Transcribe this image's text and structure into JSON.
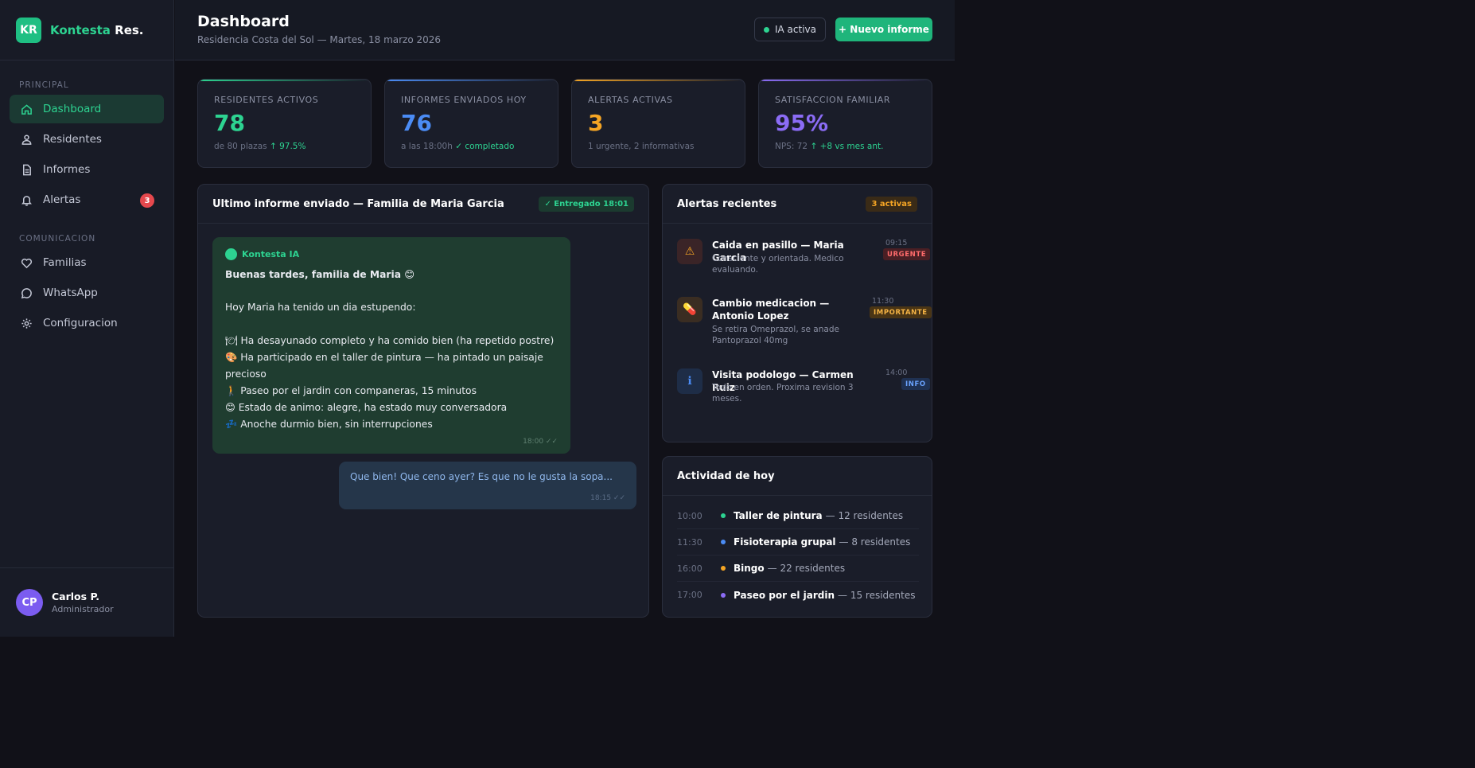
{
  "brand": {
    "initials": "KR",
    "name_a": "Kontesta",
    "name_b": "Res."
  },
  "sidebar": {
    "section_principal": "PRINCIPAL",
    "section_comunicacion": "COMUNICACION",
    "items": [
      {
        "label": "Dashboard",
        "icon": "home-icon"
      },
      {
        "label": "Residentes",
        "icon": "users-icon"
      },
      {
        "label": "Informes",
        "icon": "document-icon"
      },
      {
        "label": "Alertas",
        "icon": "bell-icon",
        "badge": "3"
      },
      {
        "label": "Familias",
        "icon": "heart-icon"
      },
      {
        "label": "WhatsApp",
        "icon": "chat-bubble-icon"
      },
      {
        "label": "Configuracion",
        "icon": "gear-icon"
      }
    ]
  },
  "user": {
    "initials": "CP",
    "name": "Carlos P.",
    "role": "Administrador"
  },
  "header": {
    "title": "Dashboard",
    "subtitle": "Residencia Costa del Sol — Martes, 18 marzo 2026",
    "ia_status": "IA activa",
    "new_report": "+ Nuevo informe"
  },
  "stats": [
    {
      "label": "RESIDENTES ACTIVOS",
      "value": "78",
      "note": "de 80 plazas",
      "highlight": "↑ 97.5%",
      "color": "#2dd391"
    },
    {
      "label": "INFORMES ENVIADOS HOY",
      "value": "76",
      "note": "a las 18:00h",
      "highlight": "✓ completado",
      "color": "#4b8cf5"
    },
    {
      "label": "ALERTAS ACTIVAS",
      "value": "3",
      "note": "1 urgente, 2 informativas",
      "highlight": "",
      "color": "#f5a524"
    },
    {
      "label": "SATISFACCION FAMILIAR",
      "value": "95%",
      "note": "NPS: 72",
      "highlight": "↑ +8 vs mes ant.",
      "color": "#8b6cf5"
    }
  ],
  "report": {
    "title": "Ultimo informe enviado — Familia de Maria Garcia",
    "status": "✓ Entregado 18:01",
    "sender": "Kontesta IA",
    "greeting": "Buenas tardes, familia de Maria 😊",
    "body": "Hoy Maria ha tenido un dia estupendo:\n\n🍽 Ha desayunado completo y ha comido bien (ha repetido postre)\n🎨 Ha participado en el taller de pintura — ha pintado un paisaje precioso\n🚶 Paseo por el jardin con companeras, 15 minutos\n😊 Estado de animo: alegre, ha estado muy conversadora\n💤 Anoche durmio bien, sin interrupciones",
    "time": "18:00 ✓✓",
    "reply": "Que bien! Que ceno ayer? Es que no le gusta la sopa...",
    "reply_time": "18:15 ✓✓"
  },
  "alerts": {
    "title": "Alertas recientes",
    "count": "3 activas",
    "items": [
      {
        "icon": "warning-icon",
        "glyph": "⚠",
        "title": "Caida en pasillo — Maria Garcia",
        "desc": "Consciente y orientada. Medico evaluando.",
        "time": "09:15",
        "tag": "URGENTE"
      },
      {
        "icon": "pill-icon",
        "glyph": "💊",
        "title": "Cambio medicacion — Antonio Lopez",
        "desc": "Se retira Omeprazol, se anade Pantoprazol 40mg",
        "time": "11:30",
        "tag": "IMPORTANTE"
      },
      {
        "icon": "info-icon",
        "glyph": "ℹ",
        "title": "Visita podologo — Carmen Ruiz",
        "desc": "Todo en orden. Proxima revision 3 meses.",
        "time": "14:00",
        "tag": "INFO"
      }
    ]
  },
  "activity": {
    "title": "Actividad de hoy",
    "items": [
      {
        "time": "10:00",
        "title": "Taller de pintura",
        "extra": "— 12 residentes",
        "color": "#2dd391"
      },
      {
        "time": "11:30",
        "title": "Fisioterapia grupal",
        "extra": "— 8 residentes",
        "color": "#4b8cf5"
      },
      {
        "time": "16:00",
        "title": "Bingo",
        "extra": "— 22 residentes",
        "color": "#f5a524"
      },
      {
        "time": "17:00",
        "title": "Paseo por el jardin",
        "extra": "— 15 residentes",
        "color": "#8b6cf5"
      }
    ]
  }
}
